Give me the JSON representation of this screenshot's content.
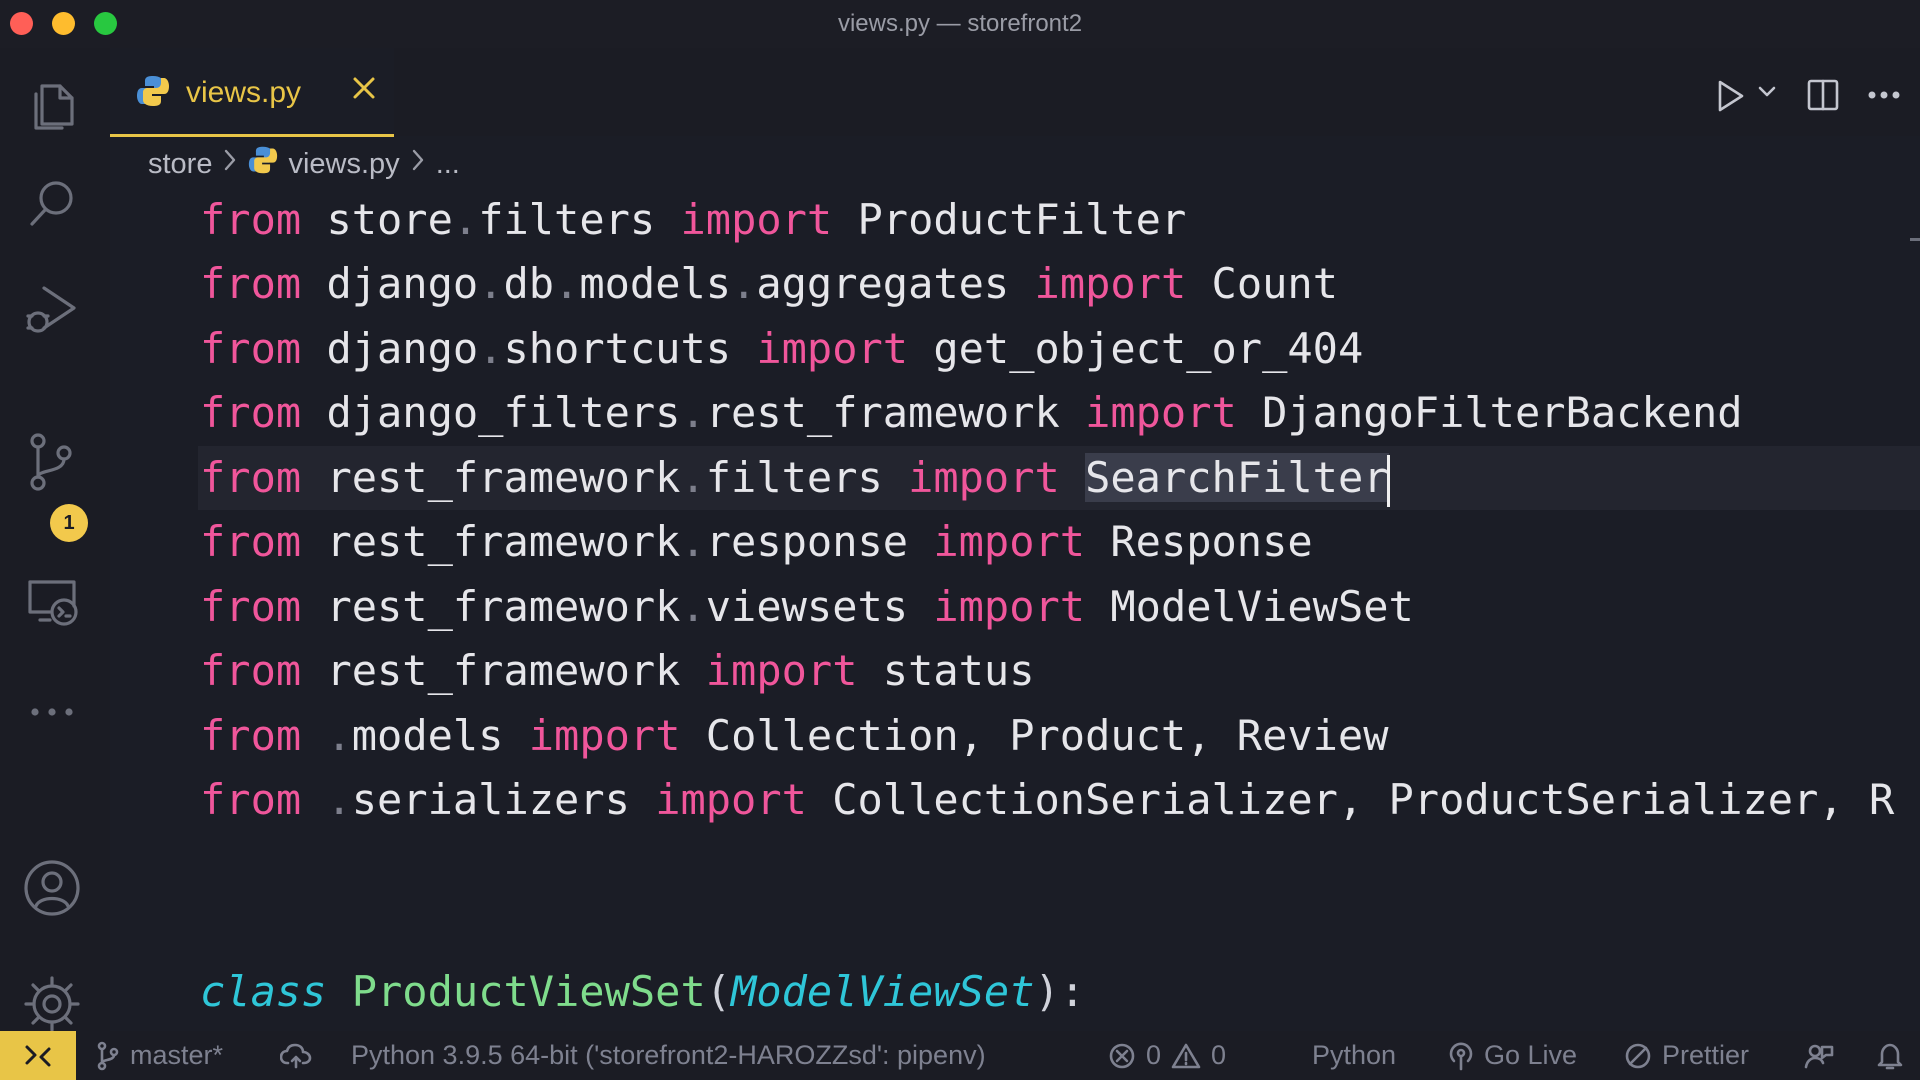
{
  "window": {
    "title": "views.py — storefront2"
  },
  "activity_bar": {
    "icons": [
      "explorer-icon",
      "search-icon",
      "run-debug-icon",
      "source-control-icon",
      "remote-explorer-icon",
      "more-icon",
      "account-icon",
      "settings-icon"
    ],
    "source_control_badge": "1"
  },
  "tab": {
    "label": "views.py"
  },
  "breadcrumb": {
    "folder": "store",
    "file": "views.py",
    "tail": "..."
  },
  "code": {
    "lines": [
      {
        "kw": "from",
        "mod": [
          [
            "store",
            "."
          ],
          [
            "filters",
            ""
          ]
        ],
        "imp": "import",
        "names": "ProductFilter"
      },
      {
        "kw": "from",
        "mod": [
          [
            "django",
            "."
          ],
          [
            "db",
            "."
          ],
          [
            "models",
            "."
          ],
          [
            "aggregates",
            ""
          ]
        ],
        "imp": "import",
        "names": "Count"
      },
      {
        "kw": "from",
        "mod": [
          [
            "django",
            "."
          ],
          [
            "shortcuts",
            ""
          ]
        ],
        "imp": "import",
        "names": "get_object_or_404"
      },
      {
        "kw": "from",
        "mod": [
          [
            "django_filters",
            "."
          ],
          [
            "rest_framework",
            ""
          ]
        ],
        "imp": "import",
        "names": "DjangoFilterBackend"
      },
      {
        "kw": "from",
        "mod": [
          [
            "rest_framework",
            "."
          ],
          [
            "filters",
            ""
          ]
        ],
        "imp": "import",
        "names": "SearchFilter"
      },
      {
        "kw": "from",
        "mod": [
          [
            "rest_framework",
            "."
          ],
          [
            "response",
            ""
          ]
        ],
        "imp": "import",
        "names": "Response"
      },
      {
        "kw": "from",
        "mod": [
          [
            "rest_framework",
            "."
          ],
          [
            "viewsets",
            ""
          ]
        ],
        "imp": "import",
        "names": "ModelViewSet"
      },
      {
        "kw": "from",
        "mod": [
          [
            "rest_framework",
            ""
          ]
        ],
        "imp": "import",
        "names": "status"
      },
      {
        "kw": "from",
        "mod": [
          [
            "",
            "."
          ],
          [
            "models",
            ""
          ]
        ],
        "imp": "import",
        "names": "Collection, Product, Review"
      },
      {
        "kw": "from",
        "mod": [
          [
            "",
            "."
          ],
          [
            "serializers",
            ""
          ]
        ],
        "imp": "import",
        "names": "CollectionSerializer, ProductSerializer, R"
      }
    ],
    "class_line": {
      "kw": "class",
      "name": "ProductViewSet",
      "open": "(",
      "base": "ModelViewSet",
      "close": "):"
    }
  },
  "status_bar": {
    "branch": "master*",
    "interpreter": "Python 3.9.5 64-bit ('storefront2-HAROZZsd': pipenv)",
    "errors": "0",
    "warnings": "0",
    "language": "Python",
    "go_live": "Go Live",
    "prettier": "Prettier"
  },
  "colors": {
    "accent": "#e8c547",
    "keyword": "#f0569b",
    "class_keyword": "#2fc6d8",
    "class_name": "#7fdc8c"
  }
}
